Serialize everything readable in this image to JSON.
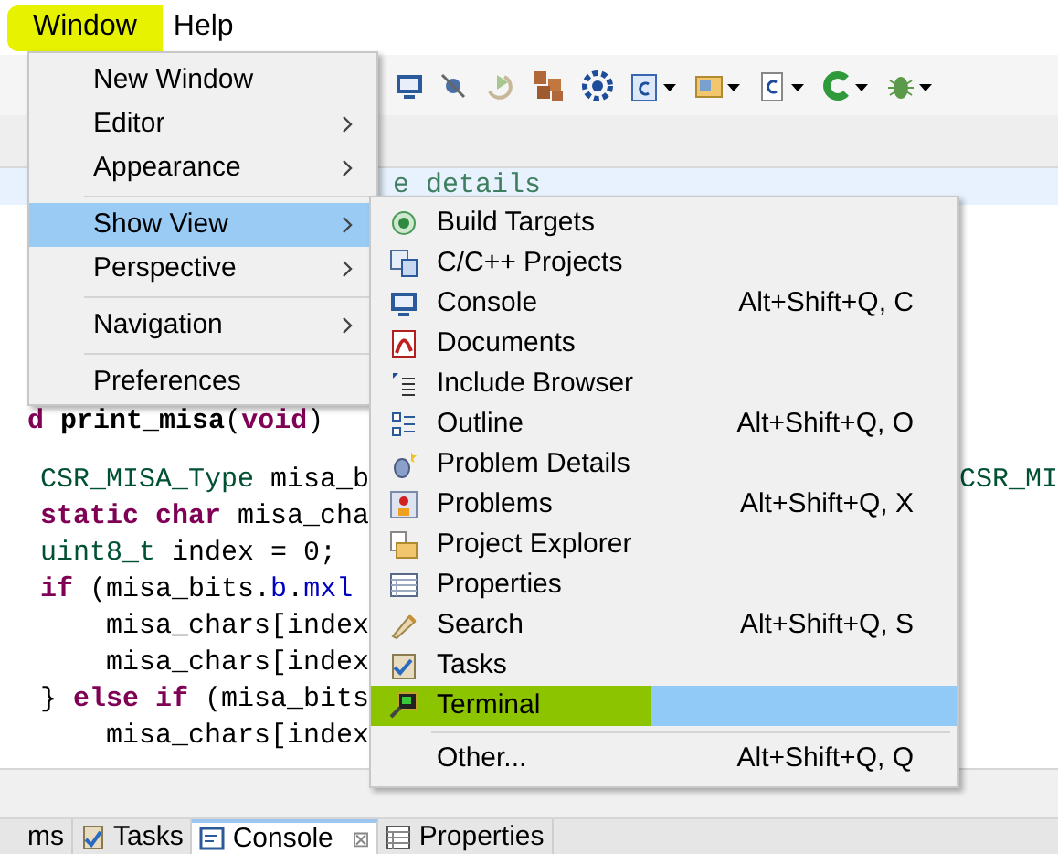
{
  "menubar": [
    {
      "label": "Window",
      "selected": true
    },
    {
      "label": "Help",
      "selected": false
    }
  ],
  "window_menu": [
    {
      "kind": "item",
      "label": "New Window",
      "submenu": false,
      "selected": false
    },
    {
      "kind": "item",
      "label": "Editor",
      "submenu": true,
      "selected": false
    },
    {
      "kind": "item",
      "label": "Appearance",
      "submenu": true,
      "selected": false
    },
    {
      "kind": "separator"
    },
    {
      "kind": "item",
      "label": "Show View",
      "submenu": true,
      "selected": true
    },
    {
      "kind": "item",
      "label": "Perspective",
      "submenu": true,
      "selected": false
    },
    {
      "kind": "separator"
    },
    {
      "kind": "item",
      "label": "Navigation",
      "submenu": true,
      "selected": false
    },
    {
      "kind": "separator"
    },
    {
      "kind": "item",
      "label": "Preferences",
      "submenu": false,
      "selected": false
    }
  ],
  "show_view_menu": [
    {
      "kind": "item",
      "label": "Build Targets",
      "selected": false
    },
    {
      "kind": "item",
      "label": "C/C++ Projects",
      "selected": false
    },
    {
      "kind": "item",
      "label": "Console",
      "shortcut": "Alt+Shift+Q, C",
      "selected": false
    },
    {
      "kind": "item",
      "label": "Documents",
      "selected": false
    },
    {
      "kind": "item",
      "label": "Include Browser",
      "selected": false
    },
    {
      "kind": "item",
      "label": "Outline",
      "shortcut": "Alt+Shift+Q, O",
      "selected": false
    },
    {
      "kind": "item",
      "label": "Problem Details",
      "selected": false
    },
    {
      "kind": "item",
      "label": "Problems",
      "shortcut": "Alt+Shift+Q, X",
      "selected": false
    },
    {
      "kind": "item",
      "label": "Project Explorer",
      "selected": false
    },
    {
      "kind": "item",
      "label": "Properties",
      "selected": false
    },
    {
      "kind": "item",
      "label": "Search",
      "shortcut": "Alt+Shift+Q, S",
      "selected": false
    },
    {
      "kind": "item",
      "label": "Tasks",
      "selected": false
    },
    {
      "kind": "item",
      "label": "Terminal",
      "selected": true
    },
    {
      "kind": "separator"
    },
    {
      "kind": "item",
      "label": "Other...",
      "shortcut": "Alt+Shift+Q, Q",
      "selected": false
    }
  ],
  "editor_lines": [
    {
      "kind": "comment",
      "tokens": [
        {
          "kind": "comment",
          "text": "e details"
        }
      ]
    },
    {
      "kind": "code",
      "tokens": [
        {
          "kind": "keyword",
          "text": "d"
        },
        {
          "kind": "bold",
          "text": " print_misa"
        },
        {
          "kind": "plain",
          "text": "("
        },
        {
          "kind": "keyword",
          "text": "void"
        },
        {
          "kind": "plain",
          "text": ")"
        }
      ]
    },
    {
      "kind": "code",
      "tokens": [
        {
          "kind": "type",
          "text": "CSR_MISA_Type"
        },
        {
          "kind": "plain",
          "text": " misa_b"
        }
      ],
      "right": "CSR_MI"
    },
    {
      "kind": "code",
      "tokens": [
        {
          "kind": "keyword",
          "text": "static char"
        },
        {
          "kind": "plain",
          "text": " misa_cha"
        }
      ]
    },
    {
      "kind": "code",
      "tokens": [
        {
          "kind": "type",
          "text": "uint8_t"
        },
        {
          "kind": "plain",
          "text": " index = 0;"
        }
      ]
    },
    {
      "kind": "code",
      "tokens": [
        {
          "kind": "keyword",
          "text": "if"
        },
        {
          "kind": "plain",
          "text": " (misa_bits."
        },
        {
          "kind": "field",
          "text": "b"
        },
        {
          "kind": "plain",
          "text": "."
        },
        {
          "kind": "field",
          "text": "mxl"
        }
      ]
    },
    {
      "kind": "nested",
      "tokens": [
        {
          "kind": "plain",
          "text": "misa_chars[index"
        }
      ]
    },
    {
      "kind": "nested",
      "tokens": [
        {
          "kind": "plain",
          "text": "misa_chars[index"
        }
      ]
    },
    {
      "kind": "code",
      "tokens": [
        {
          "kind": "plain",
          "text": "} "
        },
        {
          "kind": "keyword",
          "text": "else if"
        },
        {
          "kind": "plain",
          "text": " (misa_bits"
        }
      ]
    },
    {
      "kind": "nested",
      "tokens": [
        {
          "kind": "plain",
          "text": "misa_chars[index"
        }
      ]
    }
  ],
  "bottom_tabs": [
    {
      "label": "ms",
      "selected": false
    },
    {
      "label": "Tasks",
      "selected": false
    },
    {
      "label": "Console",
      "close": "⊠",
      "selected": true
    },
    {
      "label": "Properties",
      "selected": false
    }
  ]
}
